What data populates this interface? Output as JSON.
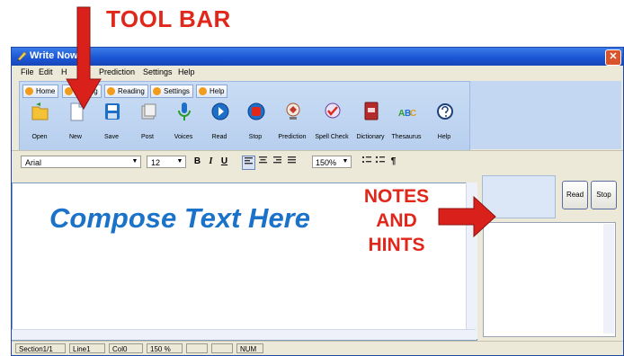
{
  "annotations": {
    "toolbar_label": "TOOL BAR",
    "notes_line1": "NOTES",
    "notes_line2": "AND",
    "notes_line3": "HINTS",
    "arrow_color": "#d9201a"
  },
  "window": {
    "title": "Write Now!",
    "close_glyph": "✕"
  },
  "menu": [
    "File",
    "Edit",
    "H",
    "Prediction",
    "Settings",
    "Help"
  ],
  "tabs": [
    {
      "label": "Home"
    },
    {
      "label": "Writing"
    },
    {
      "label": "Reading"
    },
    {
      "label": "Settings"
    },
    {
      "label": "Help"
    }
  ],
  "tools": [
    {
      "label": "Open",
      "icon": "open-folder-icon"
    },
    {
      "label": "New",
      "icon": "new-document-icon"
    },
    {
      "label": "Save",
      "icon": "save-icon"
    },
    {
      "label": "Post",
      "icon": "post-icon"
    },
    {
      "label": "Voices",
      "icon": "microphone-icon"
    },
    {
      "label": "Read",
      "icon": "play-icon"
    },
    {
      "label": "Stop",
      "icon": "stop-icon"
    },
    {
      "label": "Prediction",
      "icon": "prediction-icon"
    },
    {
      "label": "Spell Check",
      "icon": "spell-check-icon"
    },
    {
      "label": "Dictionary",
      "icon": "dictionary-icon"
    },
    {
      "label": "Thesaurus",
      "icon": "thesaurus-icon"
    },
    {
      "label": "Help",
      "icon": "help-icon"
    }
  ],
  "format": {
    "font": "Arial",
    "size": "12",
    "bold": "B",
    "italic": "I",
    "underline": "U",
    "zoom": "150%",
    "paragraph": "¶"
  },
  "editor": {
    "content": "Compose Text Here"
  },
  "side_panel": {
    "read_label": "Read",
    "stop_label": "Stop"
  },
  "status": [
    "Section1/1",
    "Line1",
    "Col0",
    "150 %",
    "",
    "",
    "NUM"
  ]
}
